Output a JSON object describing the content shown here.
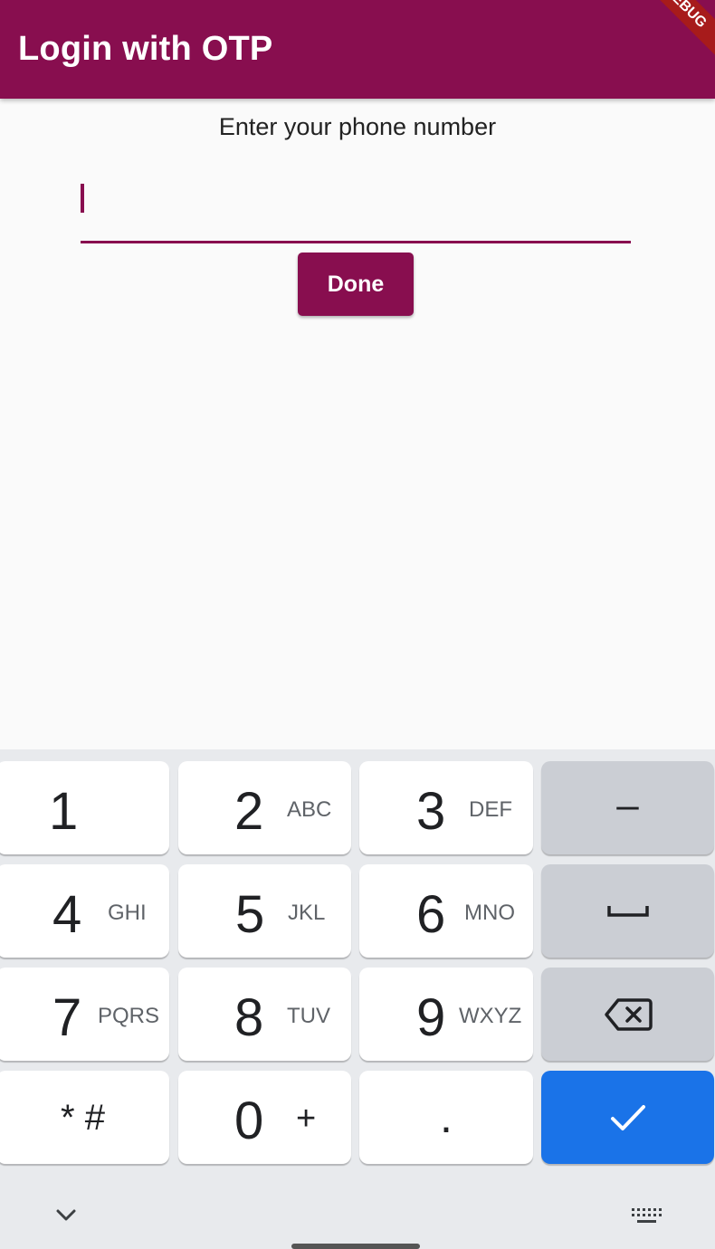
{
  "appbar": {
    "title": "Login with OTP",
    "debug_label": "DEBUG"
  },
  "main": {
    "prompt": "Enter your phone number",
    "phone_value": "",
    "done_label": "Done"
  },
  "keyboard": {
    "keys": [
      {
        "digit": "1",
        "letters": ""
      },
      {
        "digit": "2",
        "letters": "ABC"
      },
      {
        "digit": "3",
        "letters": "DEF"
      },
      {
        "digit": "4",
        "letters": "GHI"
      },
      {
        "digit": "5",
        "letters": "JKL"
      },
      {
        "digit": "6",
        "letters": "MNO"
      },
      {
        "digit": "7",
        "letters": "PQRS"
      },
      {
        "digit": "8",
        "letters": "TUV"
      },
      {
        "digit": "9",
        "letters": "WXYZ"
      },
      {
        "digit": "*",
        "letters": "#"
      },
      {
        "digit": "0",
        "letters": "+"
      },
      {
        "digit": ".",
        "letters": ""
      }
    ],
    "minus_label": "–",
    "icons": [
      "space-icon",
      "backspace-icon",
      "check-icon",
      "chevron-down-icon",
      "keyboard-icon"
    ]
  },
  "colors": {
    "primary": "#880e4f",
    "keyboard_bg": "#e8eaed",
    "key_gray": "#cbced4",
    "key_blue": "#1a73e8"
  }
}
